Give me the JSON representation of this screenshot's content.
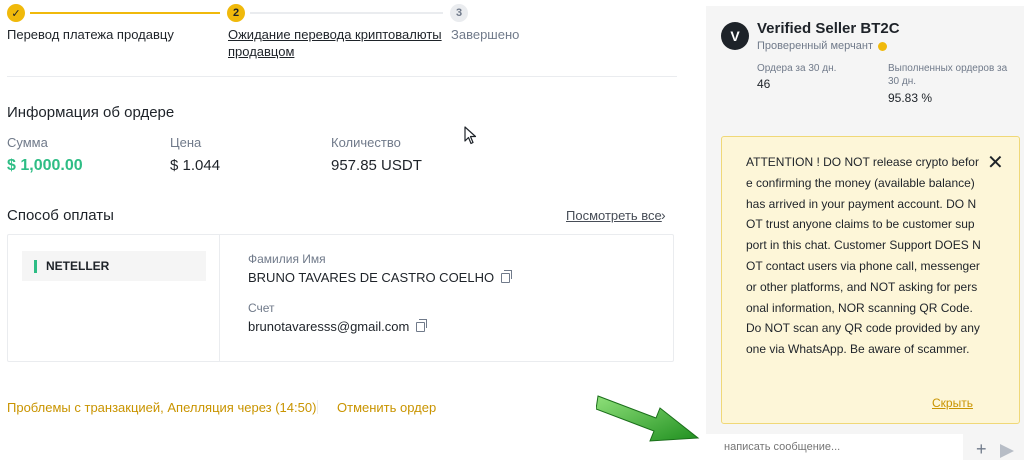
{
  "stepper": {
    "step1": {
      "number": "✓",
      "label": "Перевод платежа продавцу"
    },
    "step2": {
      "number": "2",
      "label": "Ожидание перевода криптовалюты продавцом"
    },
    "step3": {
      "number": "3",
      "label": "Завершено"
    }
  },
  "order_info": {
    "title": "Информация об ордере",
    "amount_label": "Сумма",
    "amount_value": "$ 1,000.00",
    "price_label": "Цена",
    "price_value": "$ 1.044",
    "quantity_label": "Количество",
    "quantity_value": "957.85 USDT"
  },
  "payment": {
    "title": "Способ оплаты",
    "see_all": "Посмотреть все",
    "method": "NETELLER",
    "name_label": "Фамилия Имя",
    "name_value": "BRUNO TAVARES DE CASTRO COELHO",
    "account_label": "Счет",
    "account_value": "brunotavaresss@gmail.com"
  },
  "footer": {
    "problem_text": "Проблемы с транзакцией, Апелляция через (14:50)",
    "cancel_label": "Отменить ордер"
  },
  "seller": {
    "avatar_letter": "V",
    "name": "Verified Seller BT2C",
    "merchant_label": "Проверенный мерчант",
    "orders_label": "Ордера за 30 дн.",
    "orders_value": "46",
    "completion_label": "Выполненных ордеров за 30 дн.",
    "completion_value": "95.83 %"
  },
  "chat": {
    "notice_text": "ATTENTION ! DO NOT release crypto before confirming the money (available balance) has arrived in your payment account. DO NOT trust anyone claims to be customer support in this chat. Customer Support DOES NOT contact users via phone call, messenger or other platforms, and NOT asking for personal information, NOR scanning QR Code. Do NOT scan any QR code provided by anyone via WhatsApp. Be aware of scammer.",
    "hide_label": "Скрыть",
    "input_placeholder": "написать сообщение...",
    "plus_label": "+"
  },
  "colors": {
    "accent": "#f0b90b",
    "amount_green": "#2ebd85",
    "link_gold": "#c99400",
    "arrow_green": "#2aa12a"
  }
}
